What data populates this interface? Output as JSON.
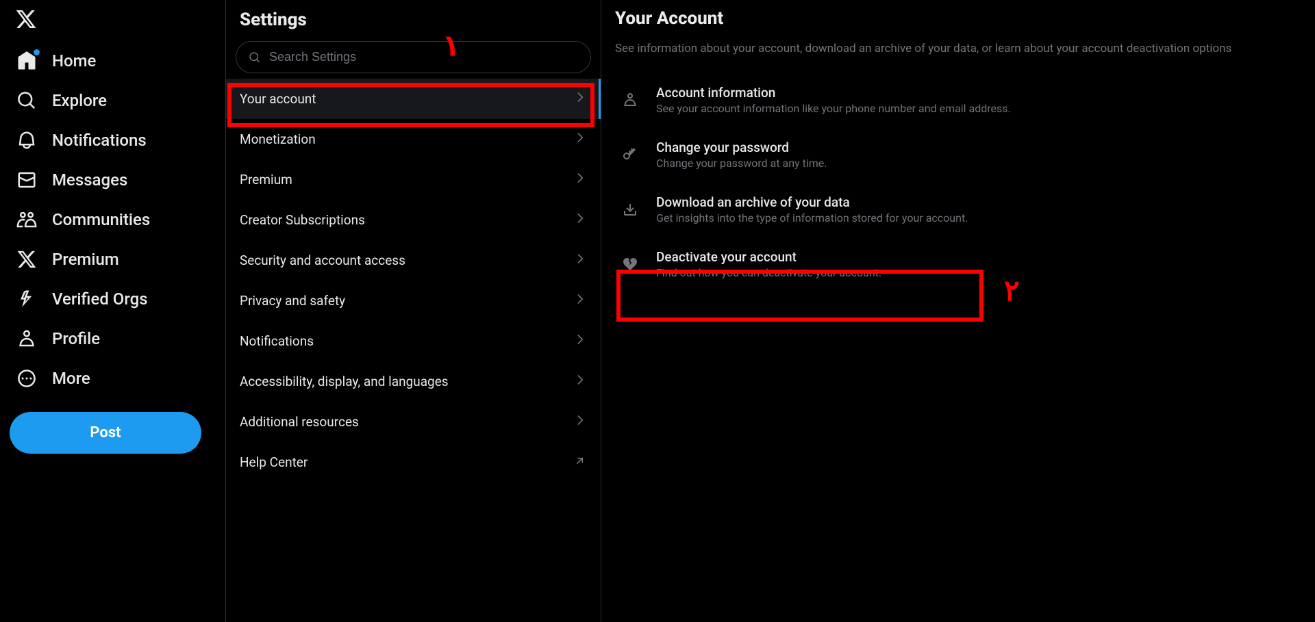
{
  "nav": {
    "items": [
      {
        "label": "Home",
        "icon": "home-icon",
        "dot": true
      },
      {
        "label": "Explore",
        "icon": "search-icon"
      },
      {
        "label": "Notifications",
        "icon": "bell-icon"
      },
      {
        "label": "Messages",
        "icon": "envelope-icon"
      },
      {
        "label": "Communities",
        "icon": "people-icon"
      },
      {
        "label": "Premium",
        "icon": "x-logo-icon"
      },
      {
        "label": "Verified Orgs",
        "icon": "lightning-icon"
      },
      {
        "label": "Profile",
        "icon": "person-icon"
      },
      {
        "label": "More",
        "icon": "more-circle-icon"
      }
    ],
    "post_label": "Post"
  },
  "settings": {
    "title": "Settings",
    "search_placeholder": "Search Settings",
    "items": [
      {
        "label": "Your account",
        "active": true
      },
      {
        "label": "Monetization"
      },
      {
        "label": "Premium"
      },
      {
        "label": "Creator Subscriptions"
      },
      {
        "label": "Security and account access"
      },
      {
        "label": "Privacy and safety"
      },
      {
        "label": "Notifications"
      },
      {
        "label": "Accessibility, display, and languages"
      },
      {
        "label": "Additional resources"
      },
      {
        "label": "Help Center",
        "external": true
      }
    ]
  },
  "detail": {
    "title": "Your Account",
    "description": "See information about your account, download an archive of your data, or learn about your account deactivation options",
    "items": [
      {
        "title": "Account information",
        "sub": "See your account information like your phone number and email address.",
        "icon": "person-outline-icon"
      },
      {
        "title": "Change your password",
        "sub": "Change your password at any time.",
        "icon": "key-icon"
      },
      {
        "title": "Download an archive of your data",
        "sub": "Get insights into the type of information stored for your account.",
        "icon": "download-icon"
      },
      {
        "title": "Deactivate your account",
        "sub": "Find out how you can deactivate your account.",
        "icon": "heartbreak-icon"
      }
    ]
  },
  "annotations": {
    "mark1": "١",
    "mark2": "٢"
  }
}
